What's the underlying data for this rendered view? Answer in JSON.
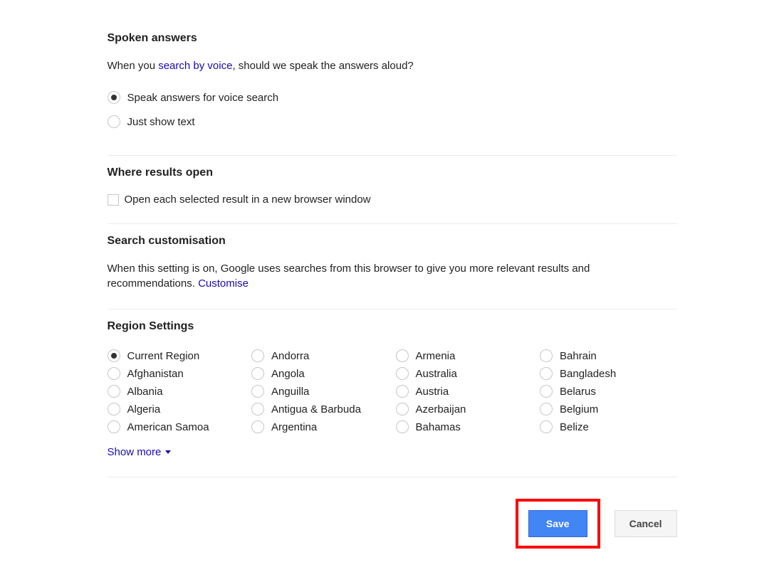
{
  "spoken": {
    "title": "Spoken answers",
    "desc_prefix": "When you ",
    "desc_link": "search by voice",
    "desc_suffix": ", should we speak the answers aloud?",
    "options": [
      {
        "label": "Speak answers for voice search",
        "checked": true
      },
      {
        "label": "Just show text",
        "checked": false
      }
    ]
  },
  "where_open": {
    "title": "Where results open",
    "checkbox_label": "Open each selected result in a new browser window",
    "checked": false
  },
  "search_custom": {
    "title": "Search customisation",
    "desc_prefix": "When this setting is on, Google uses searches from this browser to give you more relevant results and recommendations. ",
    "desc_link": "Customise"
  },
  "region": {
    "title": "Region Settings",
    "show_more": "Show more",
    "columns": [
      [
        {
          "label": "Current Region",
          "checked": true
        },
        {
          "label": "Afghanistan",
          "checked": false
        },
        {
          "label": "Albania",
          "checked": false
        },
        {
          "label": "Algeria",
          "checked": false
        },
        {
          "label": "American Samoa",
          "checked": false
        }
      ],
      [
        {
          "label": "Andorra",
          "checked": false
        },
        {
          "label": "Angola",
          "checked": false
        },
        {
          "label": "Anguilla",
          "checked": false
        },
        {
          "label": "Antigua & Barbuda",
          "checked": false
        },
        {
          "label": "Argentina",
          "checked": false
        }
      ],
      [
        {
          "label": "Armenia",
          "checked": false
        },
        {
          "label": "Australia",
          "checked": false
        },
        {
          "label": "Austria",
          "checked": false
        },
        {
          "label": "Azerbaijan",
          "checked": false
        },
        {
          "label": "Bahamas",
          "checked": false
        }
      ],
      [
        {
          "label": "Bahrain",
          "checked": false
        },
        {
          "label": "Bangladesh",
          "checked": false
        },
        {
          "label": "Belarus",
          "checked": false
        },
        {
          "label": "Belgium",
          "checked": false
        },
        {
          "label": "Belize",
          "checked": false
        }
      ]
    ]
  },
  "buttons": {
    "save": "Save",
    "cancel": "Cancel"
  }
}
